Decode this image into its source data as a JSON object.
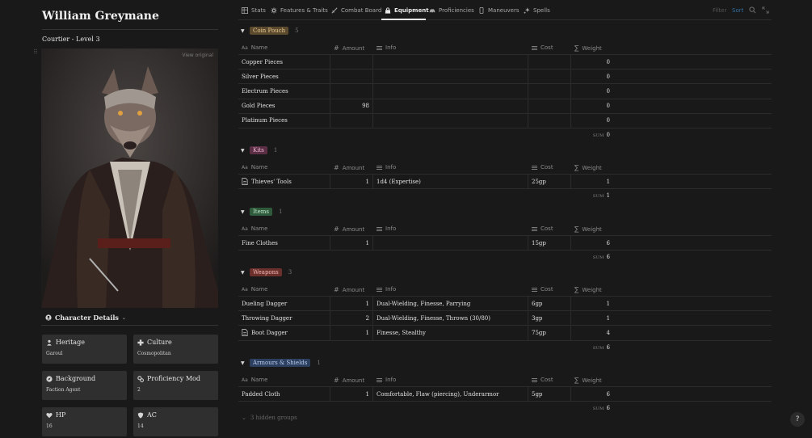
{
  "character": {
    "name": "William Greymane",
    "subtitle": "Courtier - Level 3",
    "view_original": "View original",
    "details_label": "Character Details",
    "cards": [
      {
        "label": "Heritage",
        "value": "Garoul",
        "icon": "person-icon"
      },
      {
        "label": "Culture",
        "value": "Cosmopolitan",
        "icon": "cross-icon"
      },
      {
        "label": "Background",
        "value": "Faction Agent",
        "icon": "compass-icon"
      },
      {
        "label": "Proficiency Mod",
        "value": "2",
        "icon": "gears-icon"
      },
      {
        "label": "HP",
        "value": "16",
        "icon": "heart-icon"
      },
      {
        "label": "AC",
        "value": "14",
        "icon": "shield-icon"
      }
    ]
  },
  "tabs": [
    {
      "label": "Stats",
      "icon": "table-icon"
    },
    {
      "label": "Features & Traits",
      "icon": "gear-icon"
    },
    {
      "label": "Combat Board",
      "icon": "sword-icon"
    },
    {
      "label": "Equipment",
      "icon": "bag-icon",
      "active": true
    },
    {
      "label": "Proficiencies",
      "icon": "car-icon"
    },
    {
      "label": "Maneuvers",
      "icon": "phone-icon"
    },
    {
      "label": "Spells",
      "icon": "sparkle-icon"
    }
  ],
  "toolbar": {
    "filter": "Filter",
    "sort": "Sort"
  },
  "columns": {
    "name": "Name",
    "amount": "Amount",
    "info": "Info",
    "cost": "Cost",
    "weight": "Weight"
  },
  "sum_label": "SUM",
  "groups": [
    {
      "tag": "Coin Pouch",
      "tag_bg": "#5c4a2f",
      "tag_color": "#e8c98f",
      "count": "5",
      "sum": "0",
      "rows": [
        {
          "name": "Copper Pieces",
          "amount": "",
          "info": "",
          "cost": "",
          "weight": "0"
        },
        {
          "name": "Silver Pieces",
          "amount": "",
          "info": "",
          "cost": "",
          "weight": "0"
        },
        {
          "name": "Electrum Pieces",
          "amount": "",
          "info": "",
          "cost": "",
          "weight": "0"
        },
        {
          "name": "Gold Pieces",
          "amount": "98",
          "info": "",
          "cost": "",
          "weight": "0"
        },
        {
          "name": "Platinum Pieces",
          "amount": "",
          "info": "",
          "cost": "",
          "weight": "0"
        }
      ]
    },
    {
      "tag": "Kits",
      "tag_bg": "#5a2f45",
      "tag_color": "#f0b6d2",
      "count": "1",
      "sum": "1",
      "rows": [
        {
          "name": "Thieves' Tools",
          "doc": true,
          "amount": "1",
          "info": "1d4 (Expertise)",
          "cost": "25gp",
          "weight": "1"
        }
      ]
    },
    {
      "tag": "Items",
      "tag_bg": "#2f5a3c",
      "tag_color": "#bfe8c8",
      "count": "1",
      "sum": "6",
      "rows": [
        {
          "name": "Fine Clothes",
          "amount": "1",
          "info": "",
          "cost": "15gp",
          "weight": "6"
        }
      ]
    },
    {
      "tag": "Weapons",
      "tag_bg": "#6b2f2c",
      "tag_color": "#f3b9b2",
      "count": "3",
      "sum": "6",
      "rows": [
        {
          "name": "Dueling Dagger",
          "amount": "1",
          "info": "Dual-Wielding, Finesse, Parrying",
          "cost": "6gp",
          "weight": "1"
        },
        {
          "name": "Throwing Dagger",
          "amount": "2",
          "info": "Dual-Wielding, Finesse, Thrown (30/80)",
          "cost": "3gp",
          "weight": "1"
        },
        {
          "name": "Boot Dagger",
          "doc": true,
          "amount": "1",
          "info": "Finesse, Stealthy",
          "cost": "75gp",
          "weight": "4"
        }
      ]
    },
    {
      "tag": "Armours & Shields",
      "tag_bg": "#2c3f5e",
      "tag_color": "#b8cdf0",
      "count": "1",
      "sum": "6",
      "rows": [
        {
          "name": "Padded Cloth",
          "amount": "1",
          "info": "Comfortable, Flaw (piercing), Underarmor",
          "cost": "5gp",
          "weight": "6"
        }
      ]
    }
  ],
  "hidden_groups": "3 hidden groups",
  "help": "?"
}
